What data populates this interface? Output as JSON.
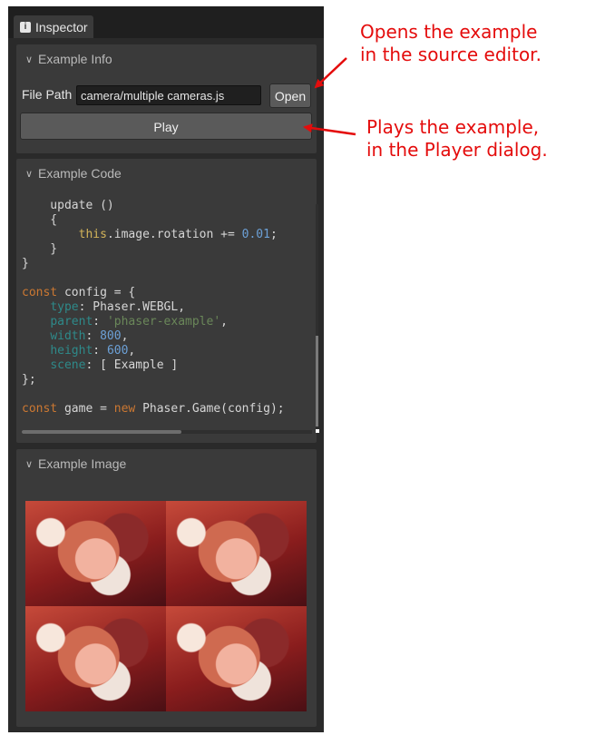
{
  "inspector": {
    "tab_label": "Inspector",
    "info_icon_glyph": "i"
  },
  "example_info": {
    "header": "Example Info",
    "file_path_label": "File Path",
    "file_path_value": "camera/multiple cameras.js",
    "open_label": "Open",
    "play_label": "Play"
  },
  "example_code": {
    "header": "Example Code",
    "lines": [
      [
        {
          "t": "    update ()",
          "c": ""
        }
      ],
      [
        {
          "t": "    {",
          "c": ""
        }
      ],
      [
        {
          "t": "        ",
          "c": ""
        },
        {
          "t": "this",
          "c": "this"
        },
        {
          "t": ".image.rotation += ",
          "c": ""
        },
        {
          "t": "0.01",
          "c": "num"
        },
        {
          "t": ";",
          "c": ""
        }
      ],
      [
        {
          "t": "    }",
          "c": ""
        }
      ],
      [
        {
          "t": "}",
          "c": ""
        }
      ],
      [
        {
          "t": "",
          "c": ""
        }
      ],
      [
        {
          "t": "const",
          "c": "kw"
        },
        {
          "t": " config = {",
          "c": ""
        }
      ],
      [
        {
          "t": "    ",
          "c": ""
        },
        {
          "t": "type",
          "c": "prop"
        },
        {
          "t": ": Phaser.WEBGL,",
          "c": ""
        }
      ],
      [
        {
          "t": "    ",
          "c": ""
        },
        {
          "t": "parent",
          "c": "prop"
        },
        {
          "t": ": ",
          "c": ""
        },
        {
          "t": "'phaser-example'",
          "c": "str"
        },
        {
          "t": ",",
          "c": ""
        }
      ],
      [
        {
          "t": "    ",
          "c": ""
        },
        {
          "t": "width",
          "c": "prop"
        },
        {
          "t": ": ",
          "c": ""
        },
        {
          "t": "800",
          "c": "num"
        },
        {
          "t": ",",
          "c": ""
        }
      ],
      [
        {
          "t": "    ",
          "c": ""
        },
        {
          "t": "height",
          "c": "prop"
        },
        {
          "t": ": ",
          "c": ""
        },
        {
          "t": "600",
          "c": "num"
        },
        {
          "t": ",",
          "c": ""
        }
      ],
      [
        {
          "t": "    ",
          "c": ""
        },
        {
          "t": "scene",
          "c": "prop"
        },
        {
          "t": ": [ Example ]",
          "c": ""
        }
      ],
      [
        {
          "t": "};",
          "c": ""
        }
      ],
      [
        {
          "t": "",
          "c": ""
        }
      ],
      [
        {
          "t": "const",
          "c": "kw"
        },
        {
          "t": " game = ",
          "c": ""
        },
        {
          "t": "new",
          "c": "kw"
        },
        {
          "t": " Phaser.Game(config);",
          "c": ""
        }
      ]
    ]
  },
  "example_image": {
    "header": "Example Image",
    "tile_count": 4
  },
  "annotations": {
    "open_line1": "Opens the example",
    "open_line2": "in the source editor.",
    "play_line1": "Plays the example,",
    "play_line2": "in the Player dialog."
  },
  "colors": {
    "annotation": "#e40c0c",
    "panel_bg": "#3a3a3a",
    "window_bg": "#2a2a2a"
  }
}
